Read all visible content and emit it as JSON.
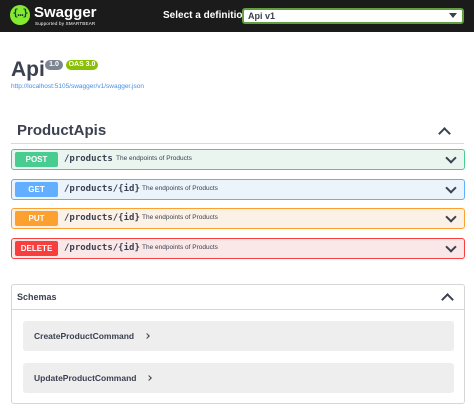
{
  "topbar": {
    "brand": "Swagger",
    "subtitle": "Supported by SMARTBEAR",
    "definition_label": "Select a definition",
    "definition_value": "Api v1",
    "logo_glyph": "{…}",
    "logo_icon": "swagger-logo-icon"
  },
  "info": {
    "title": "Api",
    "version": "1.0",
    "oas": "OAS 3.0",
    "url": "http://localhost:5105/swagger/v1/swagger.json"
  },
  "tag": {
    "name": "ProductApis",
    "operations": [
      {
        "method": "POST",
        "path": "/products",
        "description": "The endpoints of Products"
      },
      {
        "method": "GET",
        "path": "/products/{id}",
        "description": "The endpoints of Products"
      },
      {
        "method": "PUT",
        "path": "/products/{id}",
        "description": "The endpoints of Products"
      },
      {
        "method": "DELETE",
        "path": "/products/{id}",
        "description": "The endpoints of Products"
      }
    ]
  },
  "schemas": {
    "title": "Schemas",
    "models": [
      "CreateProductCommand",
      "UpdateProductCommand"
    ]
  },
  "colors": {
    "topbar": "#1b1b1b",
    "brand_green": "#85ea2d",
    "post": "#49cc90",
    "get": "#61affe",
    "put": "#fca130",
    "delete": "#f93e3e"
  }
}
